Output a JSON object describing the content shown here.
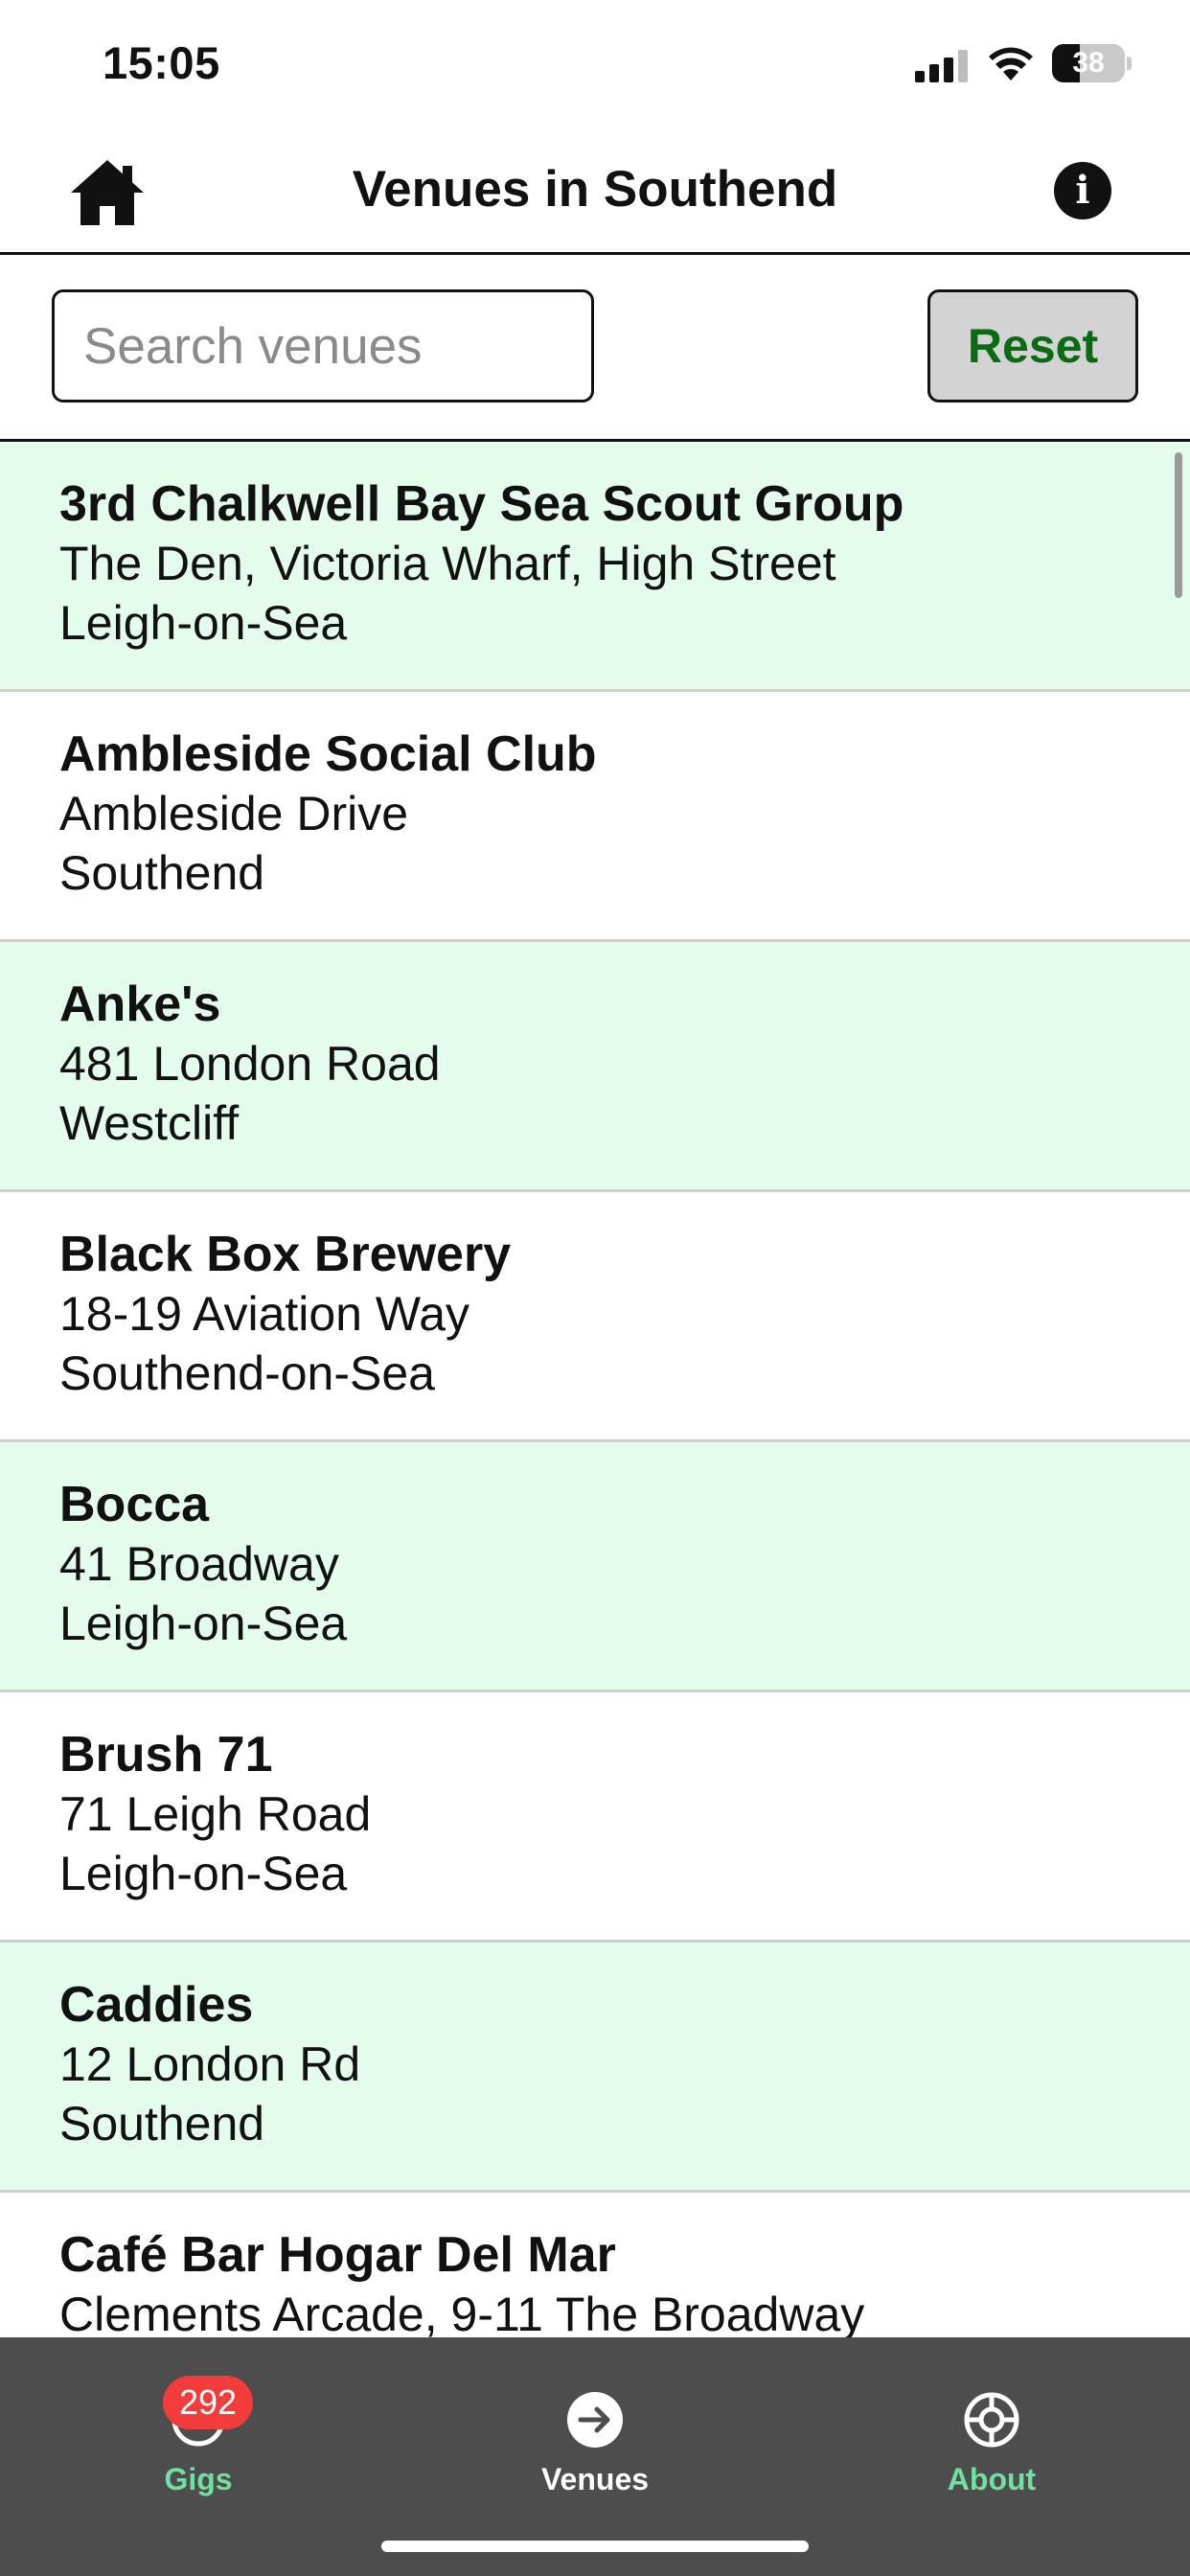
{
  "status_bar": {
    "time": "15:05",
    "battery": "38",
    "battery_level": 0.38
  },
  "header": {
    "title": "Venues in Southend"
  },
  "search": {
    "placeholder": "Search venues",
    "value": "",
    "reset_label": "Reset"
  },
  "venues": [
    {
      "name": "3rd Chalkwell Bay Sea Scout Group",
      "address": "The Den, Victoria Wharf, High Street",
      "town": "Leigh-on-Sea"
    },
    {
      "name": "Ambleside Social Club",
      "address": "Ambleside Drive",
      "town": "Southend"
    },
    {
      "name": "Anke's",
      "address": "481 London Road",
      "town": "Westcliff"
    },
    {
      "name": "Black Box Brewery",
      "address": "18-19 Aviation Way",
      "town": "Southend-on-Sea"
    },
    {
      "name": "Bocca",
      "address": "41 Broadway",
      "town": "Leigh-on-Sea"
    },
    {
      "name": "Brush 71",
      "address": "71 Leigh Road",
      "town": "Leigh-on-Sea"
    },
    {
      "name": "Caddies",
      "address": "12 London Rd",
      "town": "Southend"
    },
    {
      "name": "Café Bar Hogar Del Mar",
      "address": "Clements Arcade, 9-11 The Broadway",
      "town": ""
    }
  ],
  "tab_bar": {
    "tabs": [
      {
        "label": "Gigs",
        "badge": "292",
        "icon": "message-icon"
      },
      {
        "label": "Venues",
        "icon": "arrow-right-circle-icon"
      },
      {
        "label": "About",
        "icon": "lifebuoy-icon"
      }
    ]
  },
  "colors": {
    "row_alt": "#e3fcec",
    "tab_bar": "#4d4d4d",
    "accent_green": "#6fe0a0",
    "reset_text": "#0b6b12",
    "badge": "#f23c3c"
  }
}
